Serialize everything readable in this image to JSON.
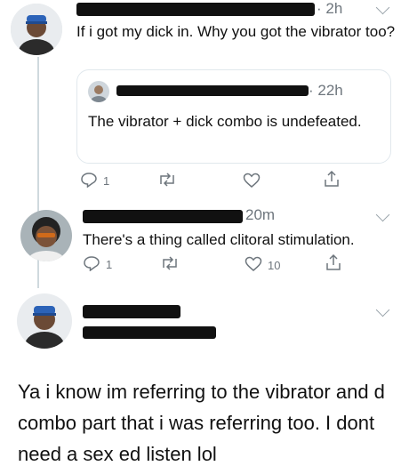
{
  "tweets": [
    {
      "time": "· 2h",
      "text": "If i got my dick in. Why you got the vibrator too?",
      "quote": {
        "time": "· 22h",
        "text": "The vibrator + dick combo is undefeated."
      },
      "actions": {
        "reply_count": "1",
        "like_count": ""
      }
    },
    {
      "time": "20m",
      "text": "There's a thing called clitoral stimulation.",
      "actions": {
        "reply_count": "1",
        "like_count": "10"
      }
    },
    {
      "text": "Ya i know im referring to the vibrator and d combo part that i was referring too. I dont need a sex ed listen lol"
    }
  ],
  "icons": {
    "reply": "reply-icon",
    "retweet": "retweet-icon",
    "like": "heart-icon",
    "share": "share-icon",
    "more": "chevron-down-icon"
  },
  "colors": {
    "meta": "#6e767d",
    "border": "#e1e8ed",
    "thread": "#cfd9de"
  }
}
